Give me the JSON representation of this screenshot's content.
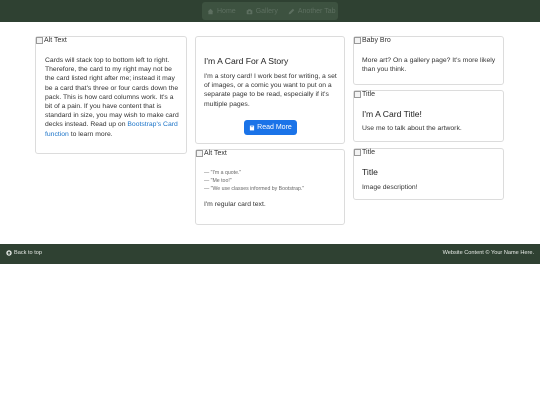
{
  "nav": {
    "items": [
      {
        "label": "Home",
        "icon": "home-icon"
      },
      {
        "label": "Gallery",
        "icon": "camera-icon"
      },
      {
        "label": "Another Tab",
        "icon": "pencil-icon"
      }
    ]
  },
  "cards": {
    "left": {
      "alt": "Alt Text",
      "text": "Cards will stack top to bottom left to right. Therefore, the card to my right may not be the card listed right after me; instead it may be a card that's three or four cards down the pack. This is how card columns work. It's a bit of a pain. If you have content that is standard in size, you may wish to make card decks instead. Read up on ",
      "link": "Bootstrap's Card function",
      "text_end": " to learn more."
    },
    "story": {
      "title": "I'm A Card For A Story",
      "text": "I'm a story card! I work best for writing, a set of images, or a comic you want to put on a separate page to be read, especially if it's multiple pages.",
      "button": "Read More"
    },
    "quote": {
      "alt": "Alt Text",
      "quotes": [
        "— \"I'm a quote.\"",
        "— \"Me too!\"",
        "— \"We use classes informed by Bootstrap.\""
      ],
      "text": "I'm regular card text."
    },
    "baby": {
      "alt": "Baby Bro",
      "text": "More art? On a gallery page? It's more likely than you think."
    },
    "card_title": {
      "alt": "Title",
      "title": "I'm A Card Title!",
      "text": "Use me to talk about the artwork."
    },
    "image_desc": {
      "alt": "Title",
      "title": "Title",
      "text": "Image description!"
    }
  },
  "footer": {
    "back": "Back to top",
    "copyright": "Website Content © Your Name Here."
  },
  "colors": {
    "bar": "#2f4132",
    "button": "#1a73e8",
    "link": "#1a73c8"
  }
}
